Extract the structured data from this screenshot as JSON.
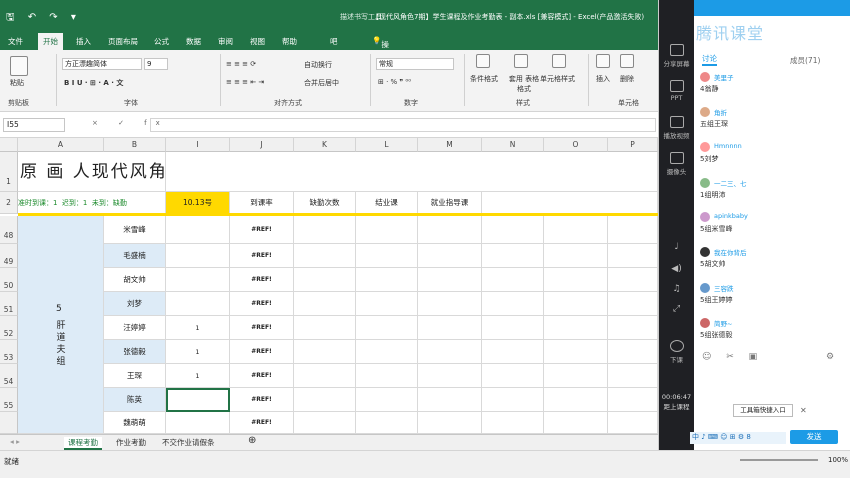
{
  "titlebar": {
    "tool": "描述书写工具",
    "doc": "【现代风角色7期】学生课程及作业考勤表 - 副本.xls [兼容模式] - Excel(产品激活失败)"
  },
  "menu": {
    "items": [
      "文件",
      "开始",
      "插入",
      "页面布局",
      "公式",
      "数据",
      "审阅",
      "视图",
      "帮助",
      "吧"
    ],
    "search": "操作说明搜索"
  },
  "ribbon": {
    "paste": "粘贴",
    "clipboard": "剪贴板",
    "font_name": "方正漂趣简体",
    "font_size": "9",
    "font_group": "字体",
    "wrap": "自动换行",
    "merge": "合并后居中",
    "align_group": "对齐方式",
    "number_format": "常规",
    "number_group": "数字",
    "cond_format": "条件格式",
    "table_format": "套用 表格格式",
    "cell_style": "单元格样式",
    "style_group": "样式",
    "insert": "插入",
    "delete": "删除",
    "cells_group": "单元格"
  },
  "formula": {
    "cell_ref": "I55",
    "fx": "× ✓ fx",
    "value": ""
  },
  "columns": [
    "A",
    "B",
    "I",
    "J",
    "K",
    "L",
    "M",
    "N",
    "O",
    "P"
  ],
  "header_row": {
    "row1_title": "原 画 人现代风角",
    "row2": [
      "准时到课：1",
      "迟到：1",
      "未到：缺勤"
    ],
    "date": "10.13号",
    "cols": [
      "到课率",
      "缺勤次数",
      "结业课",
      "就业指导课"
    ]
  },
  "row_numbers": [
    "1",
    "2",
    "48",
    "49",
    "50",
    "51",
    "52",
    "53",
    "54",
    "55"
  ],
  "group": {
    "number": "5",
    "name": "肝道夫组"
  },
  "students": [
    {
      "name": "米雪峰",
      "highlight": false,
      "att": "",
      "rate": "#REF!"
    },
    {
      "name": "毛盛楠",
      "highlight": true,
      "att": "",
      "rate": "#REF!"
    },
    {
      "name": "胡文帅",
      "highlight": false,
      "att": "",
      "rate": "#REF!"
    },
    {
      "name": "刘梦",
      "highlight": true,
      "att": "",
      "rate": "#REF!"
    },
    {
      "name": "汪婷婷",
      "highlight": false,
      "att": "1",
      "rate": "#REF!"
    },
    {
      "name": "张德毅",
      "highlight": true,
      "att": "1",
      "rate": "#REF!"
    },
    {
      "name": "王琛",
      "highlight": false,
      "att": "1",
      "rate": "#REF!"
    },
    {
      "name": "陈英",
      "highlight": true,
      "att": "",
      "rate": "#REF!"
    },
    {
      "name": "魏萌萌",
      "highlight": false,
      "att": "",
      "rate": "#REF!"
    }
  ],
  "tabs": [
    "课程考勤",
    "作业考勤",
    "不交作业请假条"
  ],
  "status": {
    "left": "就绪",
    "zoom": "100%"
  },
  "side": {
    "logo": "腾讯课堂",
    "chat_tab": "讨论",
    "members": "成员(71)",
    "tools": [
      "分享屏幕",
      "PPT",
      "播放视频",
      "摄像头",
      "下课"
    ],
    "timer": "00:06:47",
    "timer_label": "距上课程",
    "shortcut": "工具箱快捷入口",
    "send": "发送"
  },
  "messages": [
    {
      "name": "美里子",
      "text": "4翁静",
      "color": "#e88"
    },
    {
      "name": "角折",
      "text": "五组王琛",
      "color": "#da8"
    },
    {
      "name": "Hmnnnn",
      "text": "5刘梦",
      "color": "#f99"
    },
    {
      "name": "一二三、七",
      "text": "1组明沛",
      "color": "#8b8"
    },
    {
      "name": "apinkbaby",
      "text": "5组米雪峰",
      "color": "#c9c"
    },
    {
      "name": "我在你背后",
      "text": "5胡文帅",
      "color": "#333"
    },
    {
      "name": "三容跌",
      "text": "5组王婷婷",
      "color": "#69c"
    },
    {
      "name": "简野~",
      "text": "5组张德毅",
      "color": "#c66"
    }
  ]
}
